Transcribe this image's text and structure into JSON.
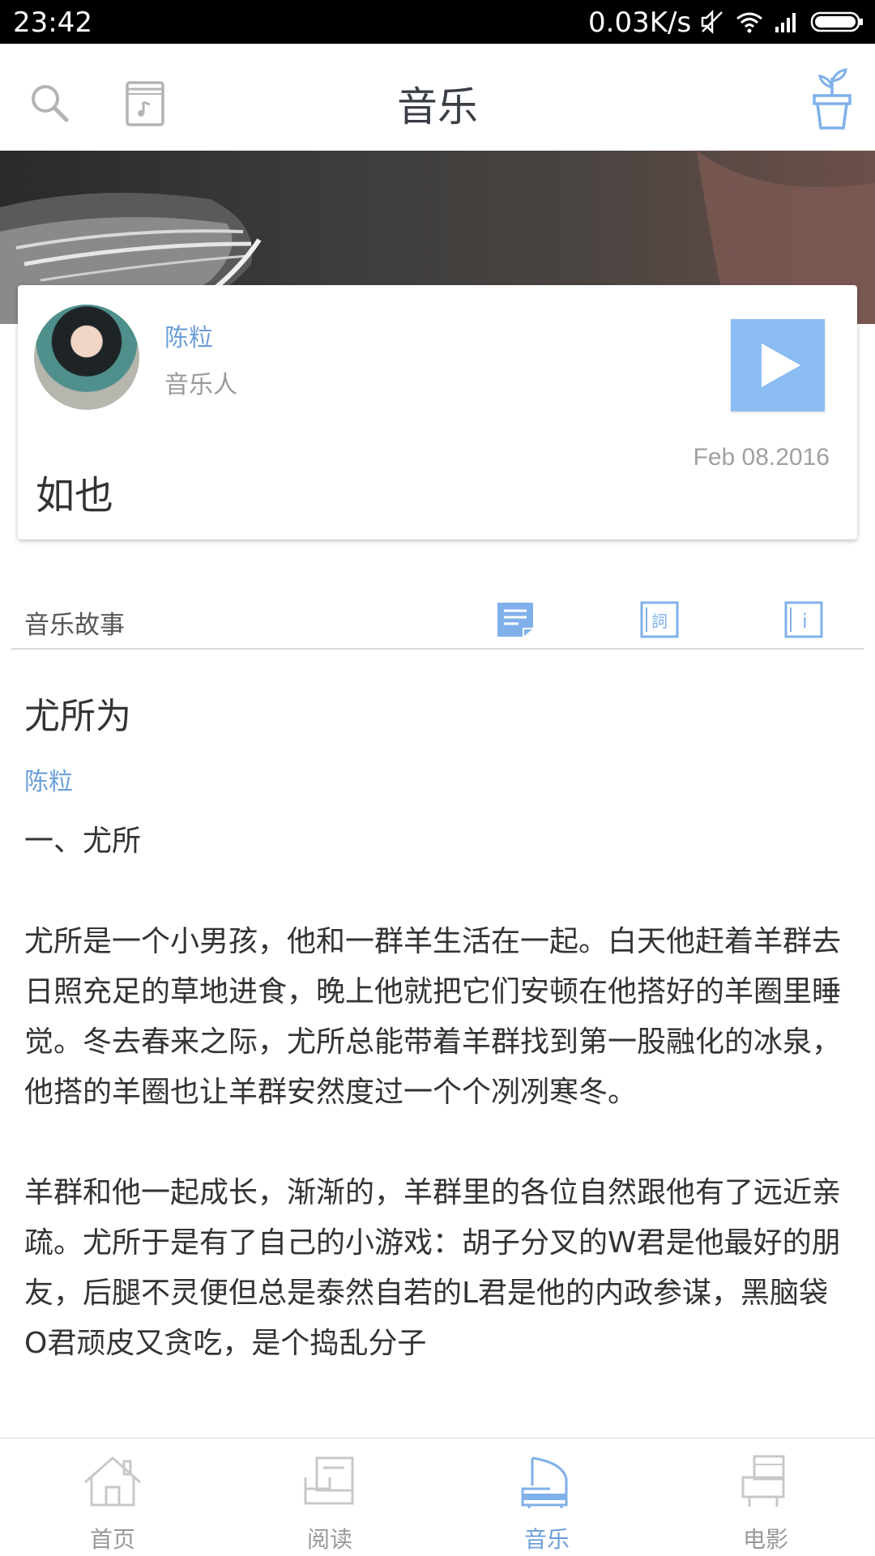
{
  "status_bar": {
    "time": "23:42",
    "network_speed": "0.03K/s"
  },
  "header": {
    "title": "音乐"
  },
  "card": {
    "author_name": "陈粒",
    "author_role": "音乐人",
    "date": "Feb 08.2016",
    "song_title": "如也"
  },
  "section": {
    "label": "音乐故事",
    "tabs": [
      "story",
      "lyrics",
      "info"
    ],
    "lyrics_glyph": "詞",
    "info_glyph": "i"
  },
  "article": {
    "title": "尤所为",
    "author": "陈粒",
    "heading": "一、尤所",
    "paragraph1": "尤所是一个小男孩，他和一群羊生活在一起。白天他赶着羊群去日照充足的草地进食，晚上他就把它们安顿在他搭好的羊圈里睡觉。冬去春来之际，尤所总能带着羊群找到第一股融化的冰泉，他搭的羊圈也让羊群安然度过一个个冽冽寒冬。",
    "paragraph2": "羊群和他一起成长，渐渐的，羊群里的各位自然跟他有了远近亲疏。尤所于是有了自己的小游戏：胡子分叉的W君是他最好的朋友，后腿不灵便但总是泰然自若的L君是他的内政参谋，黑脑袋O君顽皮又贪吃，是个捣乱分子"
  },
  "bottom_nav": {
    "items": [
      {
        "label": "首页",
        "icon": "home-icon"
      },
      {
        "label": "阅读",
        "icon": "reading-icon"
      },
      {
        "label": "音乐",
        "icon": "music-icon"
      },
      {
        "label": "电影",
        "icon": "movie-icon"
      }
    ],
    "active_index": 2
  },
  "colors": {
    "accent": "#6c9fd8",
    "play_button": "#8cbdf2",
    "inactive": "#999999"
  }
}
